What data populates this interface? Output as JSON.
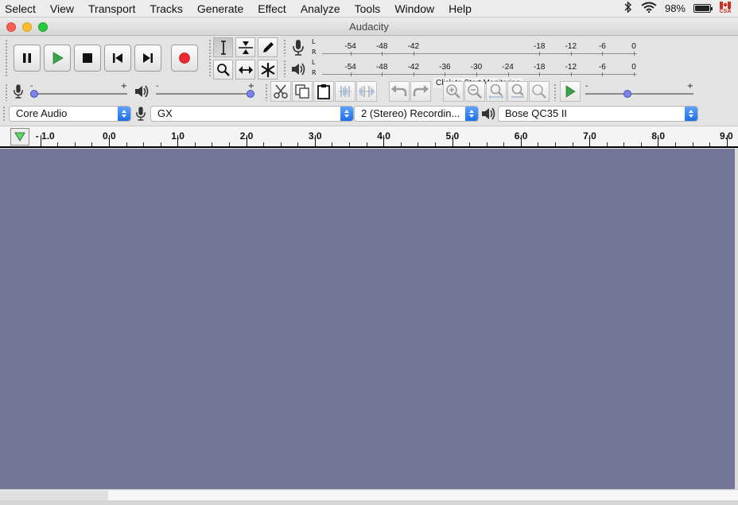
{
  "menubar": {
    "items": [
      "Select",
      "View",
      "Transport",
      "Tracks",
      "Generate",
      "Effect",
      "Analyze",
      "Tools",
      "Window",
      "Help"
    ],
    "battery_percent": "98%",
    "battery_level": 0.98,
    "input_source_label": "CSA",
    "status_icons": [
      "bluetooth-icon",
      "wifi-icon",
      "battery-icon",
      "canada-flag-icon"
    ]
  },
  "window": {
    "title": "Audacity"
  },
  "transport": {
    "buttons": [
      "pause-icon",
      "play-icon",
      "stop-icon",
      "skip-start-icon",
      "skip-end-icon",
      "record-icon"
    ],
    "colors": {
      "play": "#3da14b",
      "record": "#e8292f"
    }
  },
  "tools": [
    "selection-tool-icon",
    "envelope-tool-icon",
    "draw-tool-icon",
    "zoom-tool-icon",
    "timeshift-tool-icon",
    "multi-tool-icon"
  ],
  "meters": {
    "channels": [
      "L",
      "R"
    ],
    "record_ticks": [
      "-54",
      "-48",
      "-42",
      "-18",
      "-12",
      "-6",
      "0"
    ],
    "playback_ticks": [
      "-54",
      "-48",
      "-42",
      "-36",
      "-30",
      "-24",
      "-18",
      "-12",
      "-6",
      "0"
    ],
    "monitor_label": "Click to Start Monitoring"
  },
  "mixer": {
    "slider_minus": "-",
    "slider_plus": "+",
    "record_volume": 0.0,
    "playback_volume": 1.0,
    "play_at_speed": 0.38
  },
  "devices": {
    "host": "Core Audio",
    "recording_device": "GX",
    "recording_channels": "2 (Stereo) Recordin...",
    "playback_device": "Bose QC35 II"
  },
  "timeline": {
    "labels": [
      "- 1.0",
      "0.0",
      "1.0",
      "2.0",
      "3.0",
      "4.0",
      "5.0",
      "6.0",
      "7.0",
      "8.0",
      "9.0"
    ]
  },
  "colors": {
    "track_background": "#747698",
    "slider_knob": "#7e83e6",
    "dropdown_arrow": "#1f6fe5"
  }
}
